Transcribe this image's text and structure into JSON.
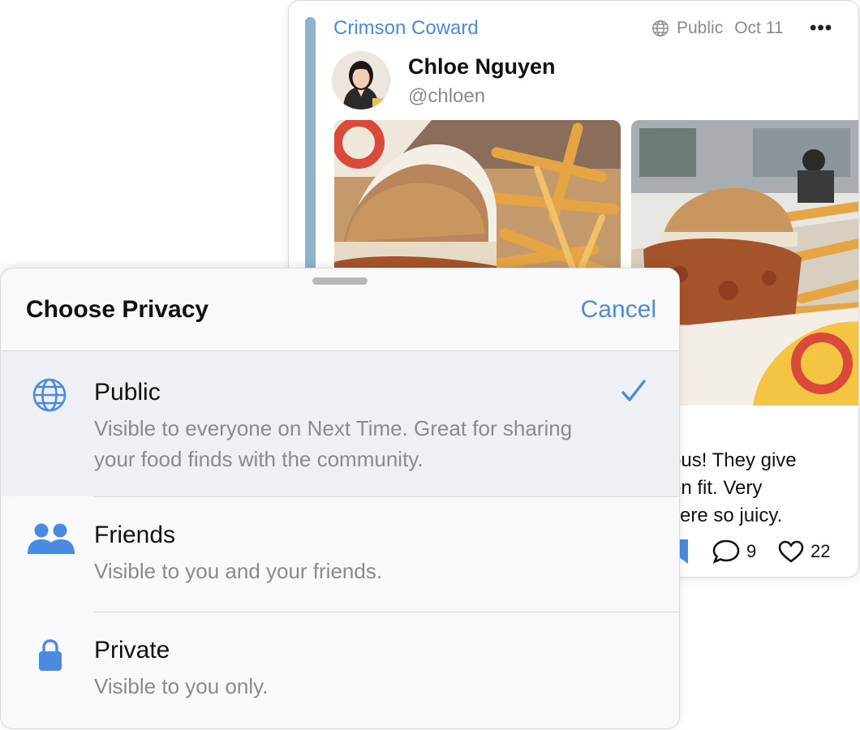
{
  "post": {
    "restaurant": "Crimson Coward",
    "visibility": "Public",
    "date": "Oct 11",
    "more_icon": "ellipsis-icon",
    "author_name": "Chloe Nguyen",
    "author_handle": "@chloen",
    "caption_lines": [
      "ous! They give",
      "en fit. Very",
      "vere so juicy."
    ],
    "comment_count": "9",
    "like_count": "22",
    "accent_color": "#4a8ae0",
    "bar_color": "#8fb3c9"
  },
  "sheet": {
    "title": "Choose Privacy",
    "cancel_label": "Cancel",
    "options": [
      {
        "icon": "globe-icon",
        "label": "Public",
        "description": "Visible to everyone on Next Time. Great for sharing your food finds with the community.",
        "selected": true
      },
      {
        "icon": "people-icon",
        "label": "Friends",
        "description": "Visible to you and your friends.",
        "selected": false
      },
      {
        "icon": "lock-icon",
        "label": "Private",
        "description": "Visible to you only.",
        "selected": false
      }
    ]
  }
}
